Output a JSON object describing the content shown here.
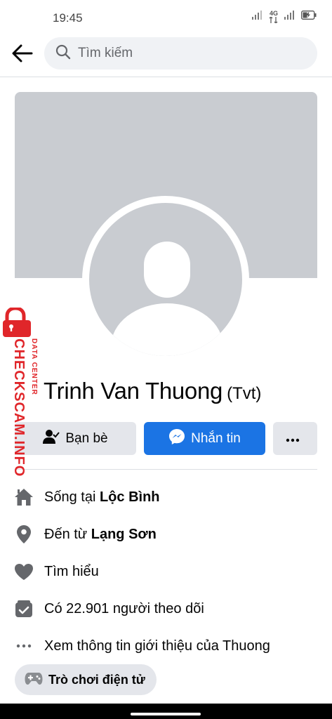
{
  "status_bar": {
    "time": "19:45",
    "network": "4G"
  },
  "search": {
    "placeholder": "Tìm kiếm"
  },
  "profile": {
    "name": "Trinh Van Thuong",
    "alternate_name": "(Tvt)"
  },
  "actions": {
    "friends_label": "Bạn bè",
    "message_label": "Nhắn tin",
    "more_label": "•••"
  },
  "info": {
    "lives_prefix": "Sống tại ",
    "lives_value": "Lộc Bình",
    "from_prefix": "Đến từ ",
    "from_value": "Lạng Sơn",
    "relationship_label": "Tìm hiểu",
    "followers_label": "Có 22.901 người theo dõi",
    "about_link": "Xem thông tin giới thiệu của Thuong"
  },
  "chip": {
    "games_label": "Trò chơi điện tử"
  },
  "watermark": {
    "brand": "CHECKSCAM.INFO",
    "sub": "DATA CENTER"
  },
  "colors": {
    "accent": "#1b74e4",
    "cover": "#c9ccd1",
    "button_gray": "#e4e6eb",
    "watermark_red": "#e0262a"
  },
  "icons": {
    "back": "arrow-left-icon",
    "search": "search-icon",
    "friends": "person-check-icon",
    "messenger": "messenger-icon",
    "home": "home-icon",
    "location": "location-pin-icon",
    "heart": "heart-icon",
    "followers": "rss-box-icon",
    "more": "ellipsis-icon",
    "games": "gamepad-icon"
  }
}
